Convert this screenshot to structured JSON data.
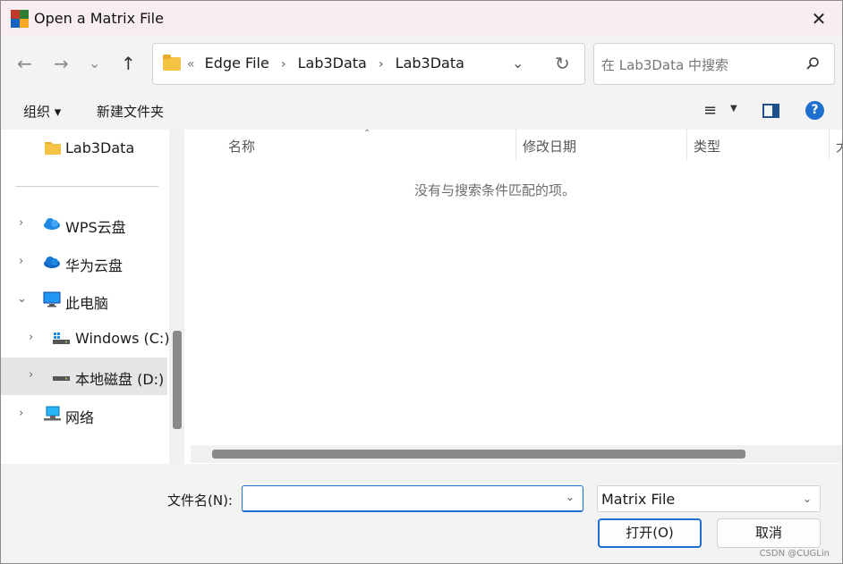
{
  "window": {
    "title": "Open a Matrix File",
    "close_glyph": "✕"
  },
  "nav": {
    "back": "←",
    "forward": "→",
    "recent": "⌄",
    "up": "↑"
  },
  "address": {
    "overflow": "«",
    "crumbs": [
      "Edge File",
      "Lab3Data",
      "Lab3Data"
    ],
    "sep": "›",
    "dropdown": "⌄",
    "refresh": "↻"
  },
  "search": {
    "placeholder": "在 Lab3Data 中搜索"
  },
  "toolbar": {
    "organize": "组织 ▾",
    "new_folder": "新建文件夹",
    "view_glyph": "≡",
    "view_dropdown": "▼",
    "help": "?"
  },
  "sidebar": {
    "items": [
      {
        "label": "Lab3Data",
        "icon": "folder-icon"
      },
      {
        "label": "WPS云盘",
        "icon": "wps-cloud-icon",
        "chevron": "›"
      },
      {
        "label": "华为云盘",
        "icon": "huawei-cloud-icon",
        "chevron": "›"
      },
      {
        "label": "此电脑",
        "icon": "computer-icon",
        "chevron": "⌄"
      },
      {
        "label": "Windows (C:)",
        "icon": "windows-drive-icon",
        "chevron": "›"
      },
      {
        "label": "本地磁盘 (D:)",
        "icon": "drive-icon",
        "chevron": "›",
        "selected": true
      },
      {
        "label": "网络",
        "icon": "network-icon",
        "chevron": "›"
      }
    ]
  },
  "filelist": {
    "columns": [
      "名称",
      "修改日期",
      "类型",
      "大"
    ],
    "sort_indicator": "⌃",
    "empty_message": "没有与搜索条件匹配的项。"
  },
  "bottom": {
    "filename_label": "文件名(N):",
    "filename_value": "",
    "filename_dropdown": "⌄",
    "filetype": "Matrix File",
    "filetype_dropdown": "⌄",
    "open_label": "打开(O)",
    "cancel_label": "取消",
    "watermark": "CSDN @CUGLin"
  },
  "colors": {
    "accent": "#1f6fd1",
    "title_bg": "#f8eef2",
    "chrome_bg": "#f3f3f3",
    "selected_bg": "#e5e5e5",
    "folder": "#f5c344"
  }
}
